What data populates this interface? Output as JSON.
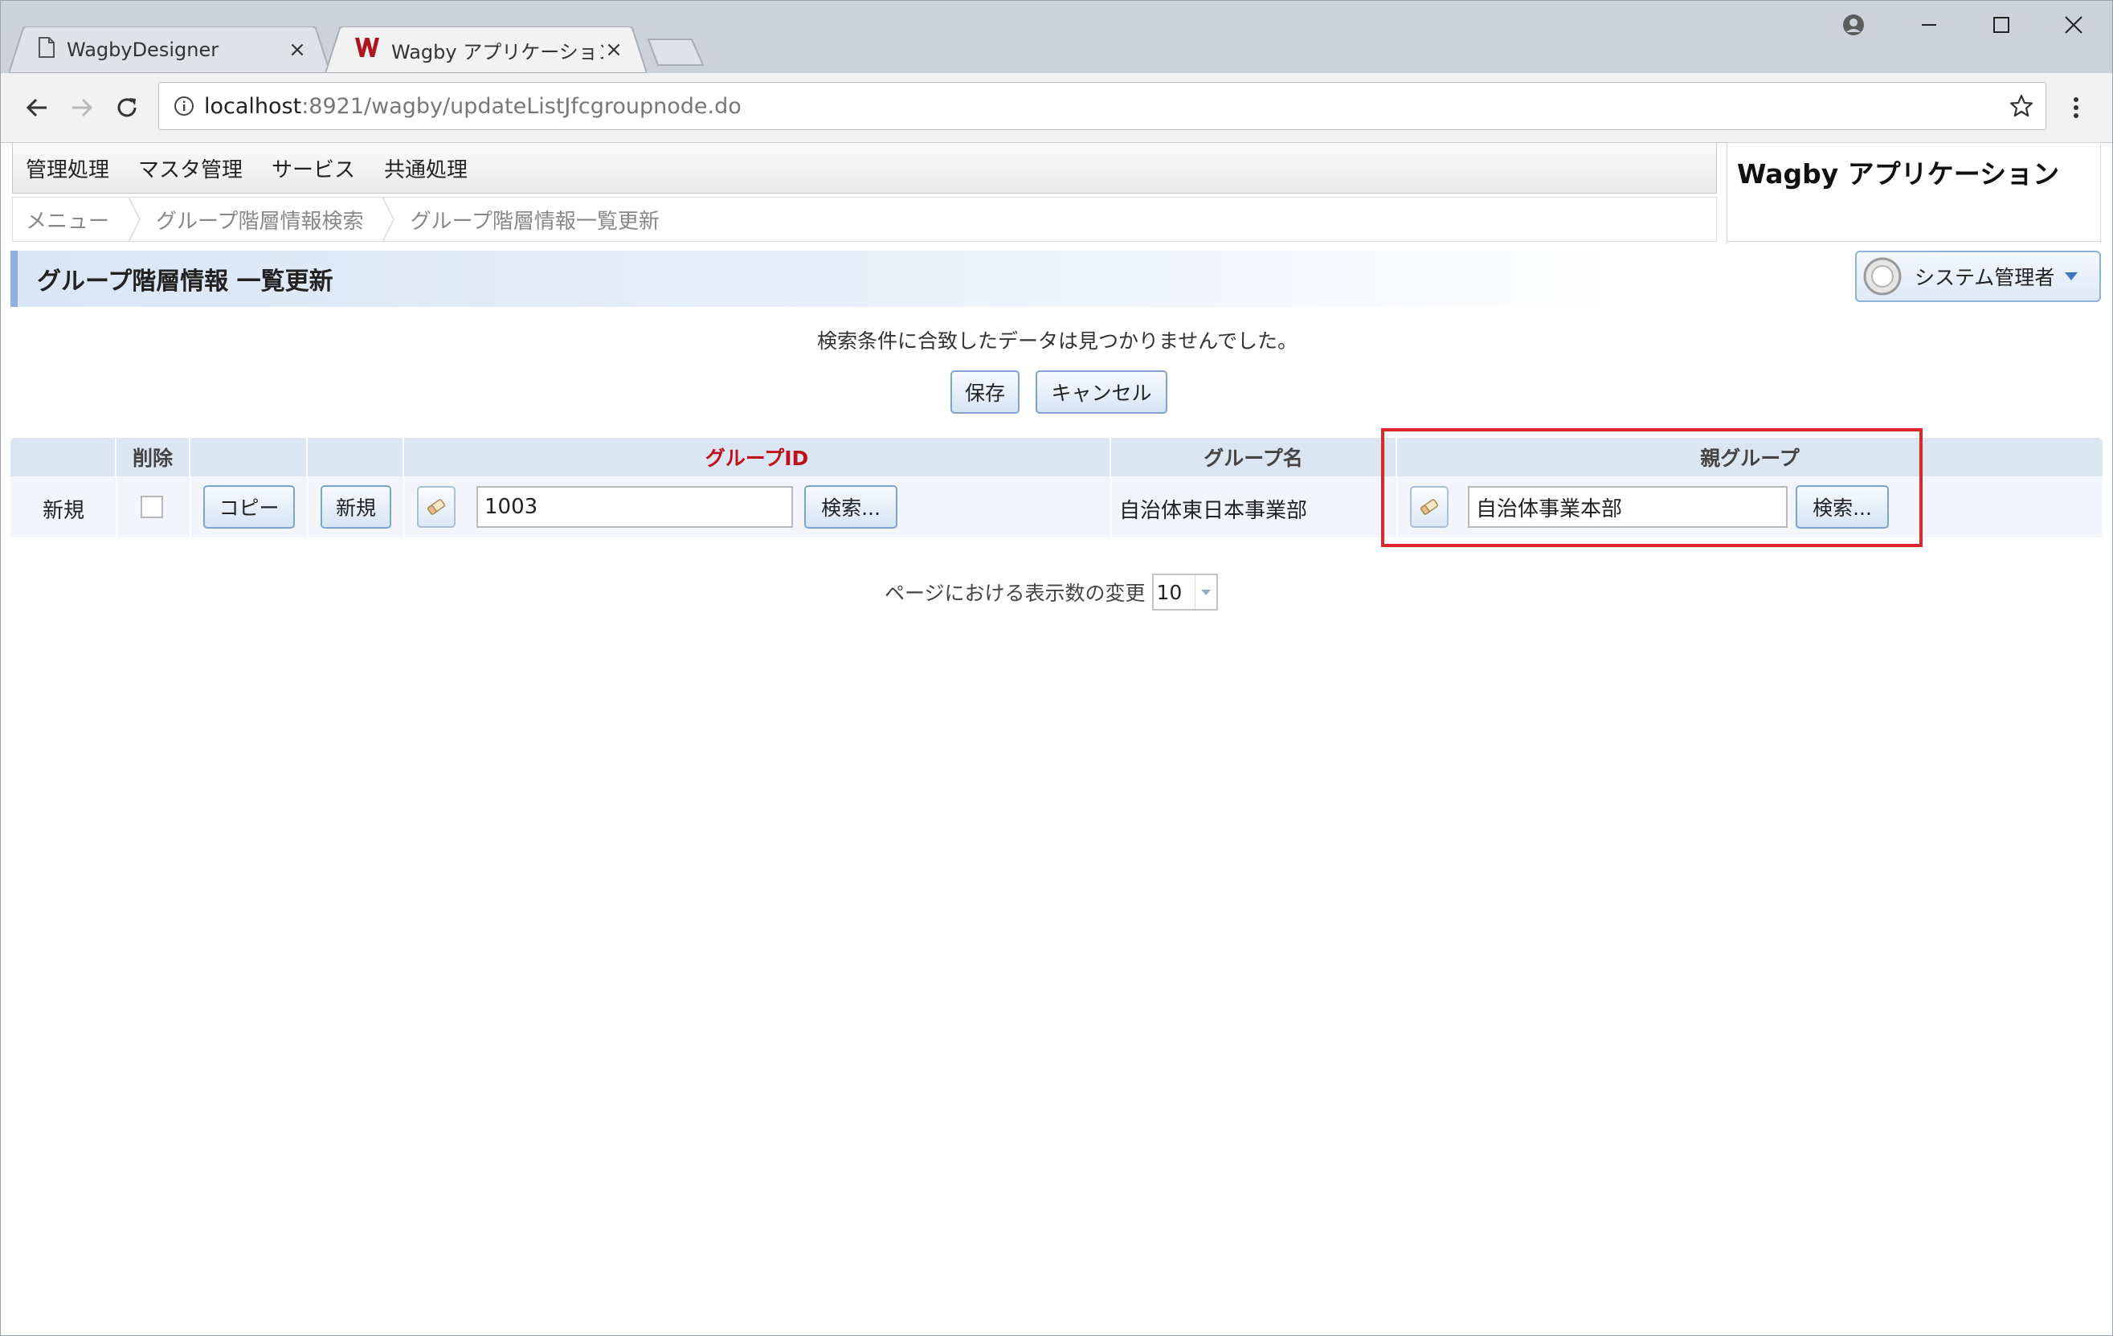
{
  "browser": {
    "tabs": [
      {
        "title": "WagbyDesigner",
        "close": "×",
        "icon": "document-icon"
      },
      {
        "title": "Wagby アプリケーション グル",
        "close": "×",
        "icon": "wagby-logo-icon"
      }
    ],
    "url": {
      "host": "localhost",
      "rest": ":8921/wagby/updateListJfcgroupnode.do"
    }
  },
  "menu": {
    "items": [
      "管理処理",
      "マスタ管理",
      "サービス",
      "共通処理"
    ]
  },
  "breadcrumb": [
    "メニュー",
    "グループ階層情報検索",
    "グループ階層情報一覧更新"
  ],
  "app_name": "Wagby アプリケーション",
  "user": {
    "name": "システム管理者"
  },
  "page_title": "グループ階層情報 一覧更新",
  "notice": "検索条件に合致したデータは見つかりませんでした。",
  "actions": {
    "save": "保存",
    "cancel": "キャンセル"
  },
  "table": {
    "headers": {
      "delete": "削除",
      "group_id": "グループID",
      "group_name": "グループ名",
      "parent_group": "親グループ"
    },
    "row": {
      "status": "新規",
      "copy_button": "コピー",
      "new_button": "新規",
      "group_id_value": "1003",
      "search_button": "検索...",
      "group_name": "自治体東日本事業部",
      "parent_group_value": "自治体事業本部",
      "parent_search_button": "検索..."
    }
  },
  "pager": {
    "label": "ページにおける表示数の変更",
    "value": "10"
  },
  "colors": {
    "accent": "#8fb0da",
    "highlight": "#e0252d",
    "required_header": "#c0101a"
  }
}
